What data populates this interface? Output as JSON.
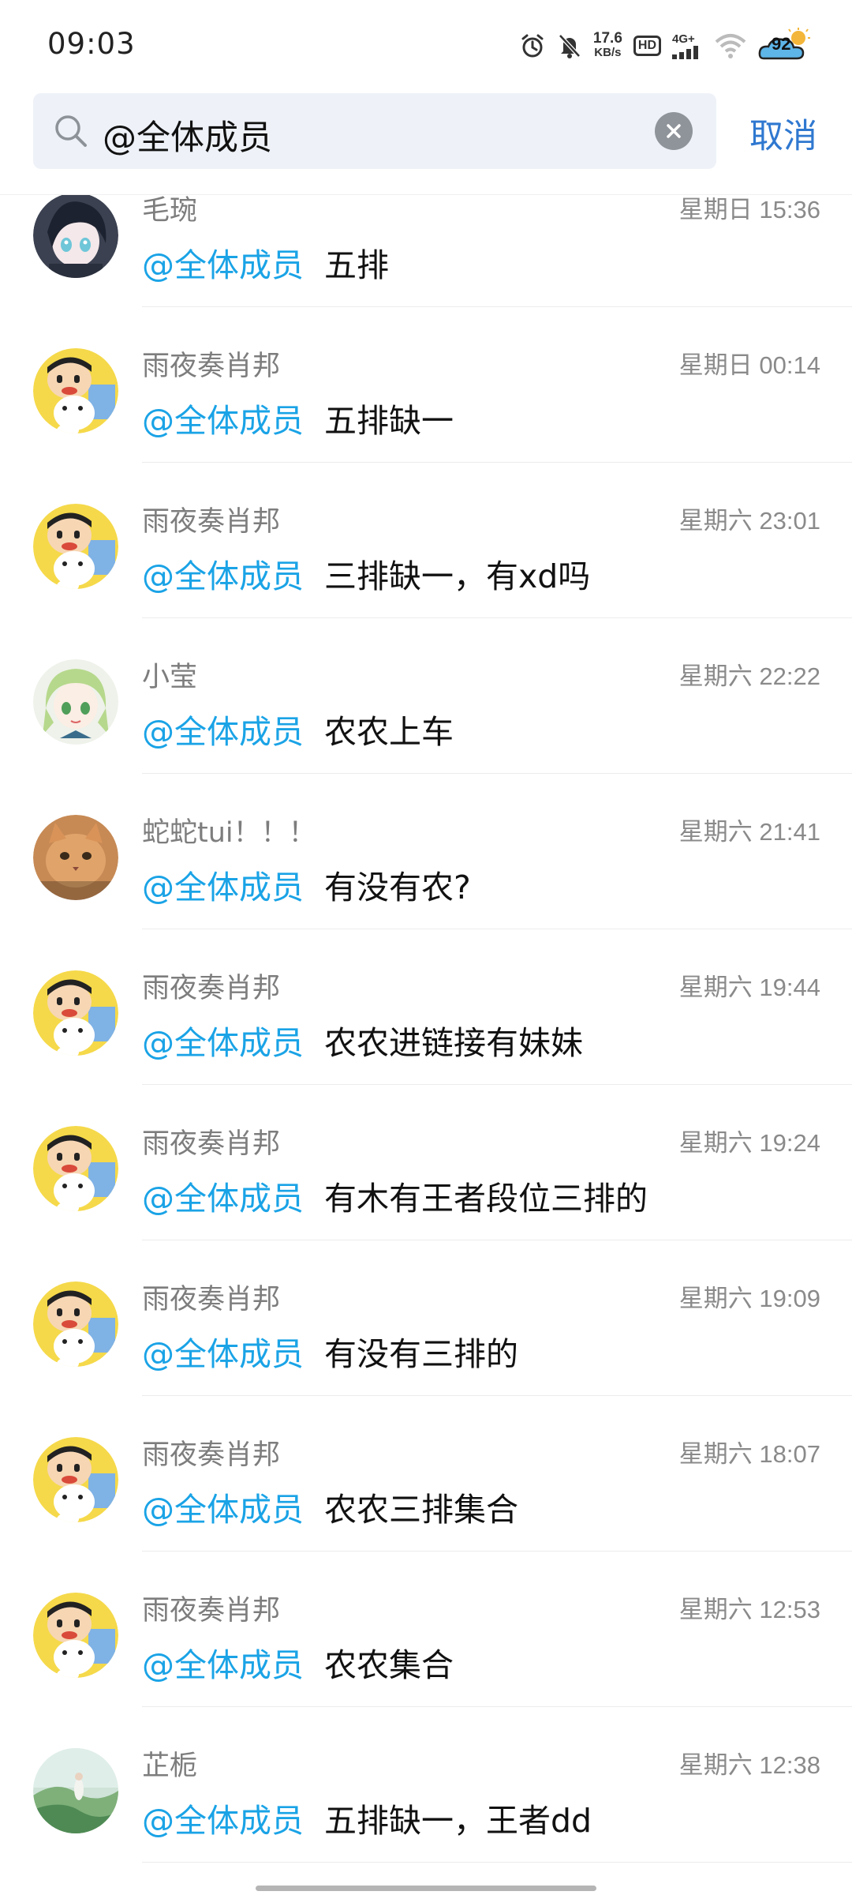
{
  "status_bar": {
    "time": "09:03",
    "net_speed": "17.6",
    "net_unit": "KB/s",
    "hd": "HD",
    "network": "4G+",
    "battery": "92",
    "icons": [
      "alarm-icon",
      "mute-icon",
      "signal-icon",
      "wifi-icon",
      "battery-icon"
    ]
  },
  "search": {
    "query": "@全体成员",
    "cancel_label": "取消",
    "icon": "search-icon",
    "clear_icon": "clear-icon"
  },
  "results": [
    {
      "name": "毛琬",
      "time": "星期日 15:36",
      "mention": "@全体成员",
      "text": "五排",
      "avatar": "anime-dark-hair"
    },
    {
      "name": "雨夜奏肖邦",
      "time": "星期日 00:14",
      "mention": "@全体成员",
      "text": "五排缺一",
      "avatar": "cartoon-yellow"
    },
    {
      "name": "雨夜奏肖邦",
      "time": "星期六 23:01",
      "mention": "@全体成员",
      "text": "三排缺一，有xd吗",
      "avatar": "cartoon-yellow"
    },
    {
      "name": "小莹",
      "time": "星期六 22:22",
      "mention": "@全体成员",
      "text": "农农上车",
      "avatar": "anime-green-hair"
    },
    {
      "name": "蛇蛇tui！！！",
      "time": "星期六 21:41",
      "mention": "@全体成员",
      "text": "有没有农?",
      "avatar": "orange-cat"
    },
    {
      "name": "雨夜奏肖邦",
      "time": "星期六 19:44",
      "mention": "@全体成员",
      "text": "农农进链接有妹妹",
      "avatar": "cartoon-yellow"
    },
    {
      "name": "雨夜奏肖邦",
      "time": "星期六 19:24",
      "mention": "@全体成员",
      "text": "有木有王者段位三排的",
      "avatar": "cartoon-yellow"
    },
    {
      "name": "雨夜奏肖邦",
      "time": "星期六 19:09",
      "mention": "@全体成员",
      "text": "有没有三排的",
      "avatar": "cartoon-yellow"
    },
    {
      "name": "雨夜奏肖邦",
      "time": "星期六 18:07",
      "mention": "@全体成员",
      "text": "农农三排集合",
      "avatar": "cartoon-yellow"
    },
    {
      "name": "雨夜奏肖邦",
      "time": "星期六 12:53",
      "mention": "@全体成员",
      "text": "农农集合",
      "avatar": "cartoon-yellow"
    },
    {
      "name": "芷栀",
      "time": "星期六 12:38",
      "mention": "@全体成员",
      "text": "五排缺一，王者dd",
      "avatar": "green-scenery"
    }
  ]
}
